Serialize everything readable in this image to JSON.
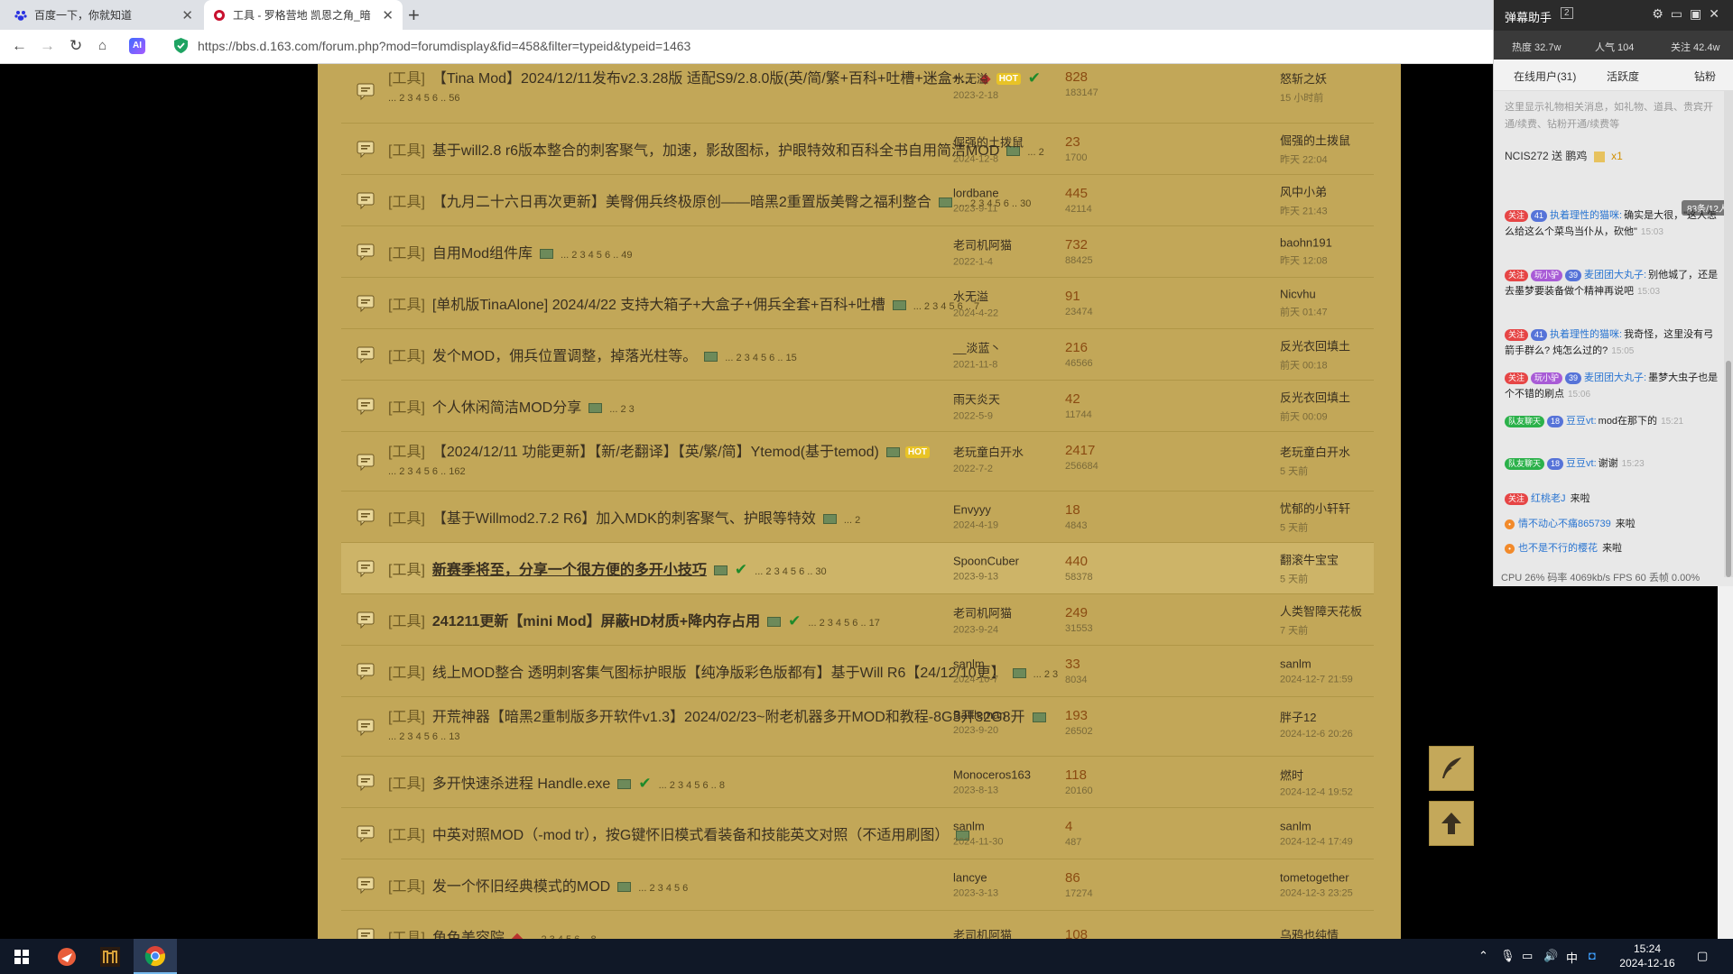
{
  "browser": {
    "tabs": [
      {
        "title": "百度一下，你就知道",
        "icon": "baidu-paw-icon"
      },
      {
        "title": "工具 - 罗格营地 凯恩之角_暗",
        "icon": "forum-logo-icon"
      }
    ],
    "new_tab": "+",
    "url": "https://bbs.d.163.com/forum.php?mod=forumdisplay&fid=458&filter=typeid&typeid=1463",
    "ai_badge": "AI"
  },
  "threads": [
    {
      "cat": "[工具]",
      "title": "【Tina Mod】2024/12/11发布v2.3.28版 适配S9/2.8.0版(英/简/繁+百科+吐槽+迷盒+...",
      "flags": {
        "tag": true,
        "hot": true,
        "check": true,
        "img": false
      },
      "pages": "... 2 3 4 5 6 .. 56",
      "tall": true,
      "author": "水无溢",
      "date": "2023-2-18",
      "replies": "828",
      "views": "183147",
      "last_user": "怒斩之妖",
      "last_time": "15 小时前"
    },
    {
      "cat": "[工具]",
      "title": "基于will2.8 r6版本整合的刺客聚气，加速，影敌图标，护眼特效和百科全书自用简洁MOD",
      "flags": {
        "img": true
      },
      "pages": "... 2",
      "author": "倔强的土拨鼠",
      "date": "2024-12-8",
      "replies": "23",
      "views": "1700",
      "last_user": "倔强的土拨鼠",
      "last_time": "昨天 22:04"
    },
    {
      "cat": "[工具]",
      "title": "【九月二十六日再次更新】美臀佣兵终极原创——暗黑2重置版美臀之福利整合",
      "flags": {
        "img": true
      },
      "pages": "... 2 3 4 5 6 .. 30",
      "author": "lordbane",
      "date": "2023-9-11",
      "replies": "445",
      "views": "42114",
      "last_user": "风中小弟",
      "last_time": "昨天 21:43"
    },
    {
      "cat": "[工具]",
      "title": "自用Mod组件库",
      "flags": {
        "img": true
      },
      "pages": "... 2 3 4 5 6 .. 49",
      "author": "老司机阿猫",
      "date": "2022-1-4",
      "replies": "732",
      "views": "88425",
      "last_user": "baohn191",
      "last_time": "昨天 12:08"
    },
    {
      "cat": "[工具]",
      "title": "[单机版TinaAlone] 2024/4/22 支持大箱子+大盒子+佣兵全套+百科+吐槽",
      "flags": {
        "img": true
      },
      "pages": "... 2 3 4 5 6 .. 7",
      "author": "水无溢",
      "date": "2024-4-22",
      "replies": "91",
      "views": "23474",
      "last_user": "Nicvhu",
      "last_time": "前天 01:47"
    },
    {
      "cat": "[工具]",
      "title": "发个MOD，佣兵位置调整，掉落光柱等。",
      "flags": {
        "img": true
      },
      "pages": "... 2 3 4 5 6 .. 15",
      "author": "__淡蓝丶",
      "date": "2021-11-8",
      "replies": "216",
      "views": "46566",
      "last_user": "反光衣回填土",
      "last_time": "前天 00:18"
    },
    {
      "cat": "[工具]",
      "title": "个人休闲简洁MOD分享",
      "flags": {
        "img": true
      },
      "pages": "... 2 3",
      "author": "雨天炎天",
      "date": "2022-5-9",
      "replies": "42",
      "views": "11744",
      "last_user": "反光衣回填土",
      "last_time": "前天 00:09"
    },
    {
      "cat": "[工具]",
      "title": "【2024/12/11 功能更新】【新/老翻译】【英/繁/简】Ytemod(基于temod)",
      "flags": {
        "img": true,
        "hot": true
      },
      "pages": "... 2 3 4 5 6 .. 162",
      "tall": true,
      "author": "老玩童白开水",
      "date": "2022-7-2",
      "replies": "2417",
      "views": "256684",
      "last_user": "老玩童白开水",
      "last_time": "5 天前"
    },
    {
      "cat": "[工具]",
      "title": "【基于Willmod2.7.2 R6】加入MDK的刺客聚气、护眼等特效",
      "flags": {
        "img": true
      },
      "pages": "... 2",
      "author": "Envyyy",
      "date": "2024-4-19",
      "replies": "18",
      "views": "4843",
      "last_user": "忧郁的小轩轩",
      "last_time": "5 天前"
    },
    {
      "cat": "[工具]",
      "title": "新赛季将至，分享一个很方便的多开小技巧",
      "flags": {
        "img": true,
        "check": true,
        "bold": true,
        "underline": true
      },
      "pages": "... 2 3 4 5 6 .. 30",
      "highlight": true,
      "author": "SpoonCuber",
      "date": "2023-9-13",
      "replies": "440",
      "views": "58378",
      "last_user": "翻滚牛宝宝",
      "last_time": "5 天前"
    },
    {
      "cat": "[工具]",
      "title": "241211更新【mini Mod】屏蔽HD材质+降内存占用",
      "flags": {
        "img": true,
        "check": true,
        "bold": true
      },
      "pages": "... 2 3 4 5 6 .. 17",
      "author": "老司机阿猫",
      "date": "2023-9-24",
      "replies": "249",
      "views": "31553",
      "last_user": "人类智障天花板",
      "last_time": "7 天前"
    },
    {
      "cat": "[工具]",
      "title": "线上MOD整合 透明刺客集气图标护眼版【纯净版彩色版都有】基于Will R6【24/12/10更】",
      "flags": {
        "img": true
      },
      "pages": "... 2 3",
      "author": "sanlm",
      "date": "2024-10-7",
      "replies": "33",
      "views": "8034",
      "last_user": "sanlm",
      "last_time": "2024-12-7 21:59"
    },
    {
      "cat": "[工具]",
      "title": "开荒神器【暗黑2重制版多开软件v1.3】2024/02/23~附老机器多开MOD和教程-8G3开32G8开",
      "flags": {
        "img": true
      },
      "pages": "... 2 3 4 5 6 .. 13",
      "tall": true,
      "author": "Battleman",
      "date": "2023-9-20",
      "replies": "193",
      "views": "26502",
      "last_user": "胖子12",
      "last_time": "2024-12-6 20:26"
    },
    {
      "cat": "[工具]",
      "title": "多开快速杀进程 Handle.exe",
      "flags": {
        "img": true,
        "check": true
      },
      "pages": "... 2 3 4 5 6 .. 8",
      "author": "Monoceros163",
      "date": "2023-8-13",
      "replies": "118",
      "views": "20160",
      "last_user": "燃时",
      "last_time": "2024-12-4 19:52"
    },
    {
      "cat": "[工具]",
      "title": "中英对照MOD（-mod tr），按G键怀旧模式看装备和技能英文对照（不适用刷图）",
      "flags": {
        "img": true
      },
      "pages": "",
      "author": "sanlm",
      "date": "2024-11-30",
      "replies": "4",
      "views": "487",
      "last_user": "sanlm",
      "last_time": "2024-12-4 17:49"
    },
    {
      "cat": "[工具]",
      "title": "发一个怀旧经典模式的MOD",
      "flags": {
        "img": true
      },
      "pages": "... 2 3 4 5 6",
      "author": "lancye",
      "date": "2023-3-13",
      "replies": "86",
      "views": "17274",
      "last_user": "tometogether",
      "last_time": "2024-12-3 23:25"
    },
    {
      "cat": "[工具]",
      "title": "角色美容院",
      "flags": {
        "tag": true
      },
      "pages": "... 2 3 4 5 6 .. 8",
      "author": "老司机阿猫",
      "date": "",
      "replies": "108",
      "views": "",
      "last_user": "乌鸦也纯情",
      "last_time": ""
    }
  ],
  "danmaku": {
    "title": "弹幕助手",
    "version": "2",
    "stats": {
      "hot": "热度 32.7w",
      "popularity": "人气 104",
      "follow": "关注 42.4w"
    },
    "tabs": [
      "在线用户(31)",
      "活跃度",
      "钻粉"
    ],
    "gift_hint": "这里显示礼物相关消息，如礼物、道具、贵宾开通/续费、钻粉开通/续费等",
    "gift": {
      "user": "NCIS272",
      "action": "送 鹏鸡",
      "count": "x1"
    },
    "online": "83条/12人",
    "messages": [
      {
        "badges": [
          "关注",
          "41"
        ],
        "user": "执着理性的猫咪:",
        "text": "确实是大很，\"这人怎么给这么个菜鸟当仆从，砍他\"",
        "time": "15:03"
      },
      {
        "badges": [
          "关注",
          "玩小驴",
          "39"
        ],
        "user": "麦团团大丸子:",
        "text": "别他城了，还是去墨梦要装备做个精神再说吧",
        "time": "15:03"
      },
      {
        "badges": [
          "关注",
          "41"
        ],
        "user": "执着理性的猫咪:",
        "text": "我奇怪，这里没有弓箭手群么? 炖怎么过的?",
        "time": "15:05"
      },
      {
        "badges": [
          "关注",
          "玩小驴",
          "39"
        ],
        "user": "麦团团大丸子:",
        "text": "墨梦大虫子也是个不错的刷点",
        "time": "15:06"
      },
      {
        "badges": [
          "队友聊天",
          "18"
        ],
        "user": "豆豆vt:",
        "text": "mod在那下的",
        "time": "15:21"
      },
      {
        "badges": [
          "队友聊天",
          "18"
        ],
        "user": "豆豆vt:",
        "text": "谢谢",
        "time": "15:23"
      }
    ],
    "joins": [
      {
        "badge": "关注",
        "user": "红桃老J",
        "text": "来啦"
      },
      {
        "badge": "circle",
        "user": "情不动心不痛865739",
        "text": "来啦"
      },
      {
        "badge": "circle",
        "user": "也不是不行的樱花",
        "text": "来啦"
      }
    ],
    "footer": "CPU 26%  码率 4069kb/s  FPS 60  丢帧 0.00%"
  },
  "taskbar": {
    "time": "15:24",
    "date": "2024-12-16",
    "ime": "中",
    "apps": [
      "windows-start-icon",
      "feishu-icon",
      "diablo-icon",
      "chrome-icon"
    ]
  },
  "colors": {
    "forum_bg": "#c2a758",
    "accent": "#8a4b12"
  }
}
